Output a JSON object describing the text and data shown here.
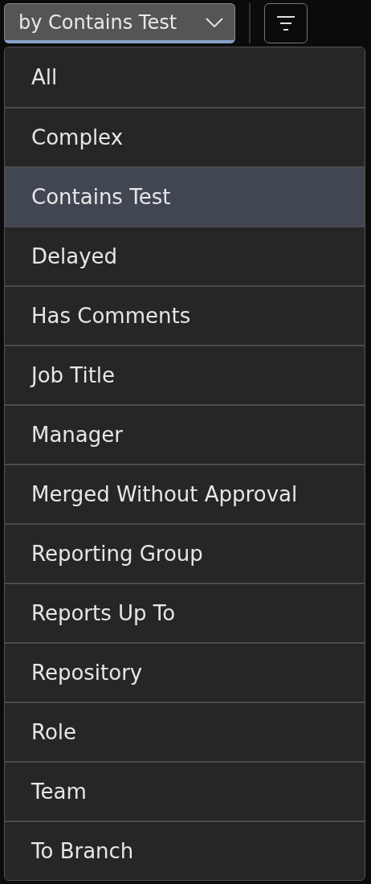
{
  "toolbar": {
    "group_select": {
      "value": "by Contains Test",
      "expanded": true
    }
  },
  "menu": {
    "items": [
      {
        "label": "All",
        "selected": false
      },
      {
        "label": "Complex",
        "selected": false
      },
      {
        "label": "Contains Test",
        "selected": true
      },
      {
        "label": "Delayed",
        "selected": false
      },
      {
        "label": "Has Comments",
        "selected": false
      },
      {
        "label": "Job Title",
        "selected": false
      },
      {
        "label": "Manager",
        "selected": false
      },
      {
        "label": "Merged Without Approval",
        "selected": false
      },
      {
        "label": "Reporting Group",
        "selected": false
      },
      {
        "label": "Reports Up To",
        "selected": false
      },
      {
        "label": "Repository",
        "selected": false
      },
      {
        "label": "Role",
        "selected": false
      },
      {
        "label": "Team",
        "selected": false
      },
      {
        "label": "To Branch",
        "selected": false
      }
    ]
  }
}
